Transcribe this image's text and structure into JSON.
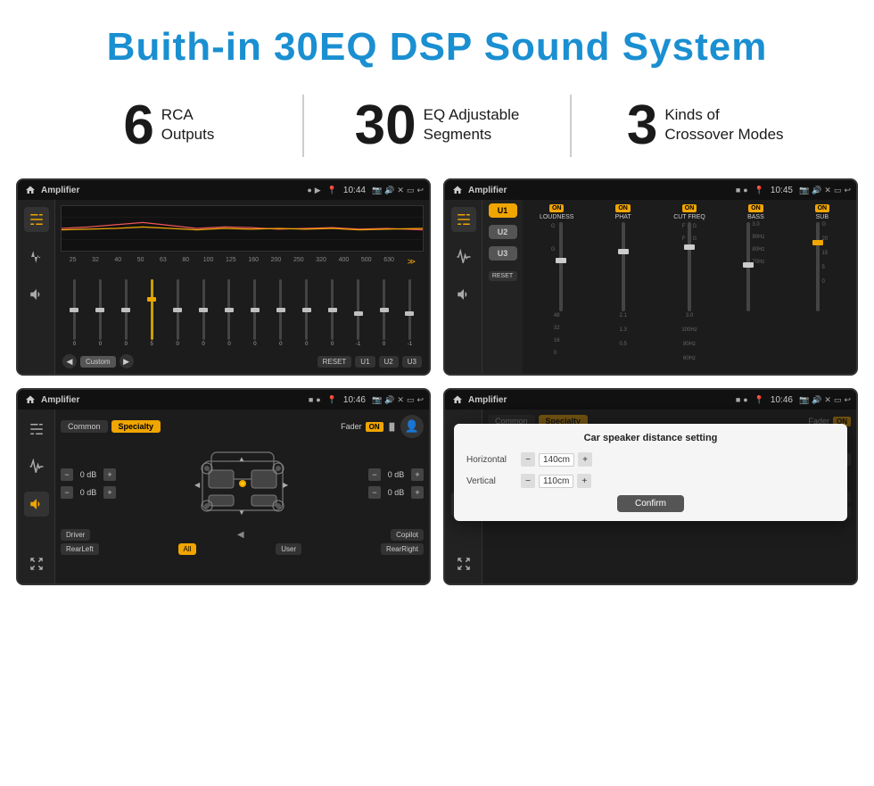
{
  "header": {
    "title": "Buith-in 30EQ DSP Sound System"
  },
  "stats": [
    {
      "number": "6",
      "line1": "RCA",
      "line2": "Outputs"
    },
    {
      "number": "30",
      "line1": "EQ Adjustable",
      "line2": "Segments"
    },
    {
      "number": "3",
      "line1": "Kinds of",
      "line2": "Crossover Modes"
    }
  ],
  "screens": [
    {
      "id": "screen1",
      "status_bar": {
        "title": "Amplifier",
        "time": "10:44",
        "icons": "📷 🔊 ✕ 🔋 ↩"
      },
      "eq_labels": [
        "25",
        "32",
        "40",
        "50",
        "63",
        "80",
        "100",
        "125",
        "160",
        "200",
        "250",
        "320",
        "400",
        "500",
        "630"
      ],
      "eq_values": [
        "0",
        "0",
        "0",
        "5",
        "0",
        "0",
        "0",
        "0",
        "0",
        "0",
        "0",
        "-1",
        "0",
        "-1"
      ],
      "eq_modes": [
        "Custom",
        "RESET",
        "U1",
        "U2",
        "U3"
      ]
    },
    {
      "id": "screen2",
      "status_bar": {
        "title": "Amplifier",
        "time": "10:45"
      },
      "u_buttons": [
        "U1",
        "U2",
        "U3"
      ],
      "sliders": [
        {
          "label": "LOUDNESS",
          "on": true
        },
        {
          "label": "PHAT",
          "on": true
        },
        {
          "label": "CUT FREQ",
          "on": true
        },
        {
          "label": "BASS",
          "on": true
        },
        {
          "label": "SUB",
          "on": true
        }
      ]
    },
    {
      "id": "screen3",
      "status_bar": {
        "title": "Amplifier",
        "time": "10:46"
      },
      "tabs": [
        "Common",
        "Specialty"
      ],
      "active_tab": "Specialty",
      "fader_label": "Fader",
      "fader_on": true,
      "db_values": [
        "0 dB",
        "0 dB",
        "0 dB",
        "0 dB"
      ],
      "bottom_btns": [
        "Driver",
        "All",
        "User",
        "Copilot",
        "RearLeft",
        "RearRight"
      ]
    },
    {
      "id": "screen4",
      "status_bar": {
        "title": "Amplifier",
        "time": "10:46"
      },
      "tabs": [
        "Common",
        "Specialty"
      ],
      "dialog": {
        "title": "Car speaker distance setting",
        "horizontal_label": "Horizontal",
        "horizontal_value": "140cm",
        "vertical_label": "Vertical",
        "vertical_value": "110cm",
        "confirm_label": "Confirm"
      }
    }
  ],
  "labels": {
    "eq_nav_arrow_left": "◀",
    "eq_nav_arrow_right": "▶",
    "eq_nav_expand": "≫",
    "minus": "−",
    "plus": "+",
    "reset": "RESET",
    "all_btn": "All"
  }
}
